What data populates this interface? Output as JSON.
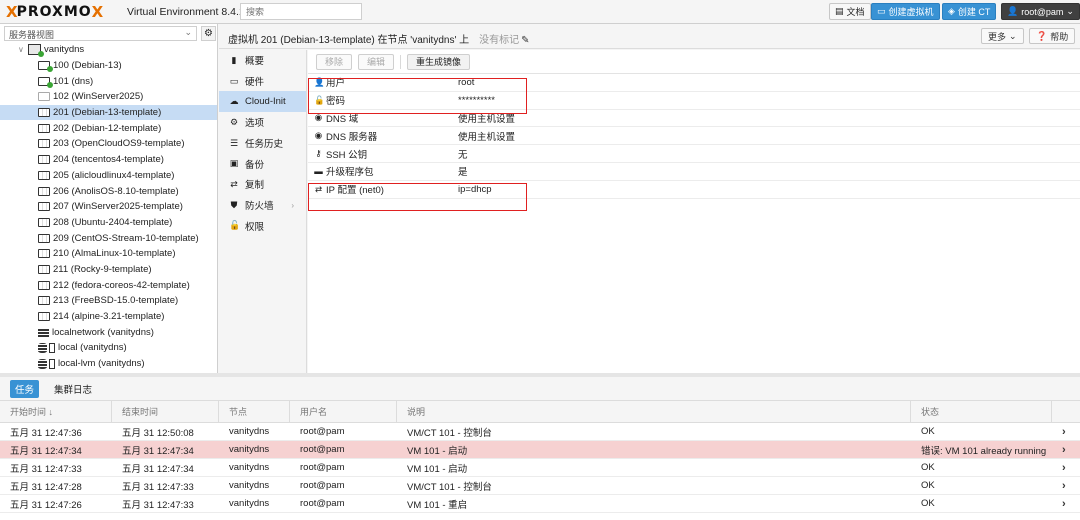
{
  "topbar": {
    "logo_x1": "X",
    "logo_text": "PROXMO",
    "logo_x2": "X",
    "version": "Virtual Environment 8.4.1",
    "search_placeholder": "搜索",
    "docs_label": "文档",
    "create_vm_label": "创建虚拟机",
    "create_ct_label": "创建 CT",
    "user_label": "root@pam"
  },
  "tree": {
    "view_label": "服务器视图",
    "node": "vanitydns",
    "items": [
      {
        "label": "100 (Debian-13)",
        "type": "vm-on"
      },
      {
        "label": "101 (dns)",
        "type": "vm-on"
      },
      {
        "label": "102 (WinServer2025)",
        "type": "vm-off"
      },
      {
        "label": "201 (Debian-13-template)",
        "type": "tpl",
        "selected": true
      },
      {
        "label": "202 (Debian-12-template)",
        "type": "tpl"
      },
      {
        "label": "203 (OpenCloudOS9-template)",
        "type": "tpl"
      },
      {
        "label": "204 (tencentos4-template)",
        "type": "tpl"
      },
      {
        "label": "205 (alicloudlinux4-template)",
        "type": "tpl"
      },
      {
        "label": "206 (AnolisOS-8.10-template)",
        "type": "tpl"
      },
      {
        "label": "207 (WinServer2025-template)",
        "type": "tpl"
      },
      {
        "label": "208 (Ubuntu-2404-template)",
        "type": "tpl"
      },
      {
        "label": "209 (CentOS-Stream-10-template)",
        "type": "tpl"
      },
      {
        "label": "210 (AlmaLinux-10-template)",
        "type": "tpl"
      },
      {
        "label": "211 (Rocky-9-template)",
        "type": "tpl"
      },
      {
        "label": "212 (fedora-coreos-42-template)",
        "type": "tpl"
      },
      {
        "label": "213 (FreeBSD-15.0-template)",
        "type": "tpl"
      },
      {
        "label": "214 (alpine-3.21-template)",
        "type": "tpl"
      },
      {
        "label": "localnetwork (vanitydns)",
        "type": "net"
      },
      {
        "label": "local (vanitydns)",
        "type": "db"
      },
      {
        "label": "local-lvm (vanitydns)",
        "type": "db"
      }
    ]
  },
  "header": {
    "title": "虚拟机 201 (Debian-13-template) 在节点 'vanitydns' 上",
    "no_tags": "没有标记",
    "more_label": "更多",
    "help_label": "帮助"
  },
  "menu": {
    "items": [
      {
        "label": "概要",
        "icon": "book-icon"
      },
      {
        "label": "硬件",
        "icon": "monitor-icon"
      },
      {
        "label": "Cloud-Init",
        "icon": "cloud-icon",
        "active": true
      },
      {
        "label": "选项",
        "icon": "gear-icon"
      },
      {
        "label": "任务历史",
        "icon": "list-icon"
      },
      {
        "label": "备份",
        "icon": "floppy-icon"
      },
      {
        "label": "复制",
        "icon": "retweet-icon"
      },
      {
        "label": "防火墙",
        "icon": "shield-icon",
        "has_more": true
      },
      {
        "label": "权限",
        "icon": "unlock-icon"
      }
    ]
  },
  "cloudinit": {
    "toolbar": {
      "remove_label": "移除",
      "edit_label": "编辑",
      "regen_label": "重生成镜像"
    },
    "rows": [
      {
        "key": "用户",
        "value": "root",
        "icon": "user-icon"
      },
      {
        "key": "密码",
        "value": "**********",
        "icon": "unlock-icon"
      },
      {
        "key": "DNS 域",
        "value": "使用主机设置",
        "icon": "globe-icon"
      },
      {
        "key": "DNS 服务器",
        "value": "使用主机设置",
        "icon": "globe-icon"
      },
      {
        "key": "SSH 公钥",
        "value": "无",
        "icon": "key-icon"
      },
      {
        "key": "升级程序包",
        "value": "是",
        "icon": "archive-icon"
      },
      {
        "key": "IP 配置 (net0)",
        "value": "ip=dhcp",
        "icon": "exchange-icon"
      }
    ]
  },
  "tasks": {
    "tabs": [
      "任务",
      "集群日志"
    ],
    "columns": [
      "开始时间 ↓",
      "结束时间",
      "节点",
      "用户名",
      "说明",
      "状态"
    ],
    "rows": [
      {
        "start": "五月 31 12:47:36",
        "end": "五月 31 12:50:08",
        "node": "vanitydns",
        "user": "root@pam",
        "desc": "VM/CT 101 - 控制台",
        "status": "OK",
        "error": false
      },
      {
        "start": "五月 31 12:47:34",
        "end": "五月 31 12:47:34",
        "node": "vanitydns",
        "user": "root@pam",
        "desc": "VM 101 - 启动",
        "status": "错误: VM 101 already running",
        "error": true
      },
      {
        "start": "五月 31 12:47:33",
        "end": "五月 31 12:47:34",
        "node": "vanitydns",
        "user": "root@pam",
        "desc": "VM 101 - 启动",
        "status": "OK",
        "error": false
      },
      {
        "start": "五月 31 12:47:28",
        "end": "五月 31 12:47:33",
        "node": "vanitydns",
        "user": "root@pam",
        "desc": "VM/CT 101 - 控制台",
        "status": "OK",
        "error": false
      },
      {
        "start": "五月 31 12:47:26",
        "end": "五月 31 12:47:33",
        "node": "vanitydns",
        "user": "root@pam",
        "desc": "VM 101 - 重启",
        "status": "OK",
        "error": false
      }
    ]
  },
  "colors": {
    "accent": "#3892d4",
    "brand": "#e57000",
    "highlight_box": "#e02020",
    "error_row": "#f6d1d1",
    "selection": "#c6dcf4"
  }
}
